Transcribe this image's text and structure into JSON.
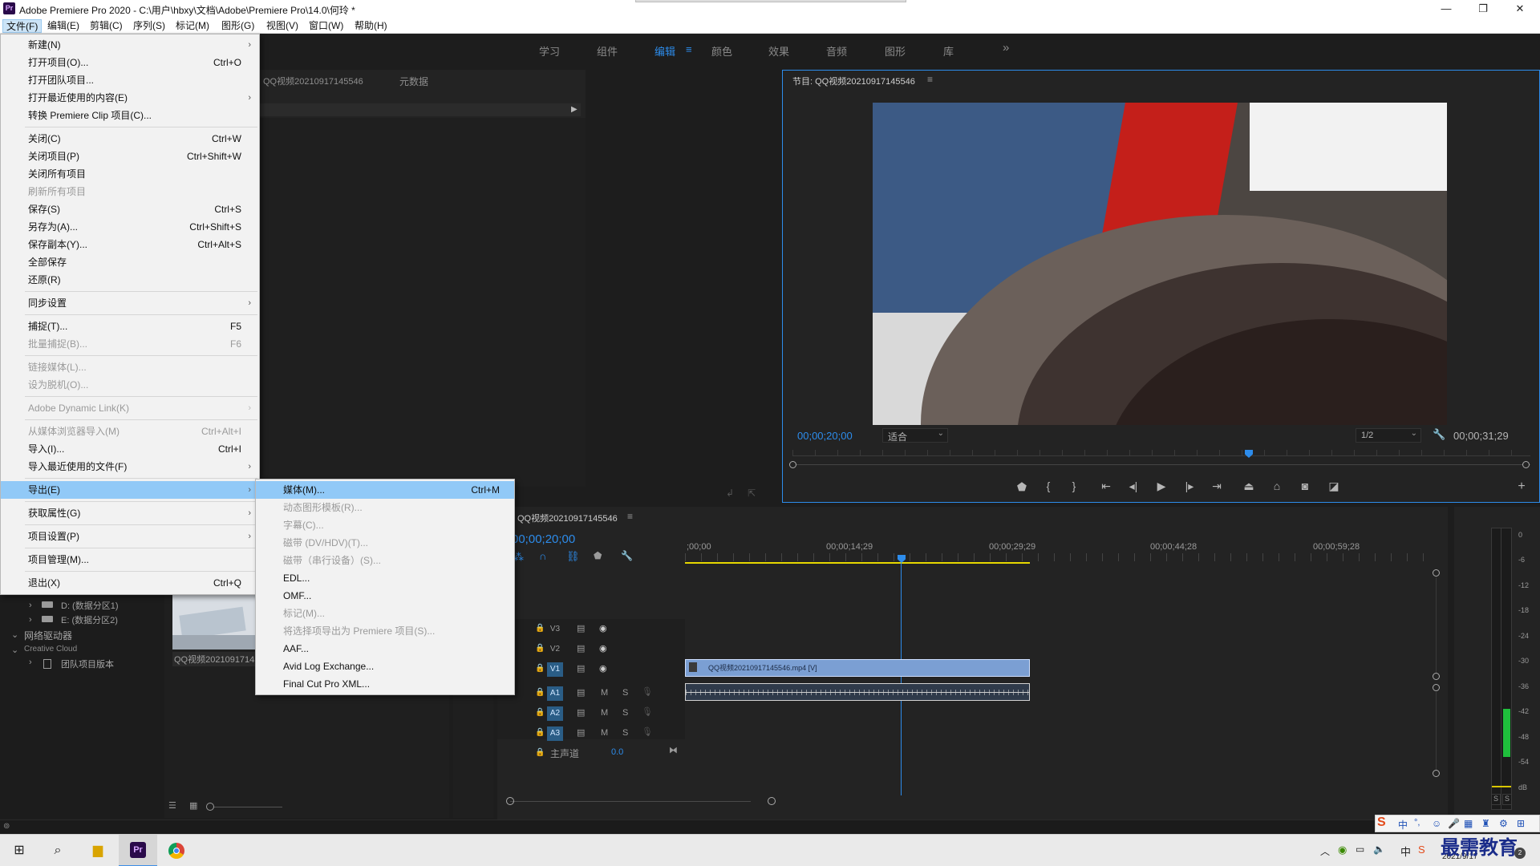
{
  "window": {
    "title": "Adobe Premiere Pro 2020 - C:\\用户\\hbxy\\文档\\Adobe\\Premiere Pro\\14.0\\何玲 *",
    "logo_text": "Pr"
  },
  "menubar": {
    "items": [
      "文件(F)",
      "编辑(E)",
      "剪辑(C)",
      "序列(S)",
      "标记(M)",
      "图形(G)",
      "视图(V)",
      "窗口(W)",
      "帮助(H)"
    ]
  },
  "workspaces": {
    "tabs": [
      "学习",
      "组件",
      "编辑",
      "颜色",
      "效果",
      "音频",
      "图形",
      "库"
    ],
    "active": "编辑",
    "overflow": "»"
  },
  "file_menu": {
    "items": [
      {
        "label": "新建(N)",
        "shortcut": "",
        "submenu": true
      },
      {
        "label": "打开项目(O)...",
        "shortcut": "Ctrl+O"
      },
      {
        "label": "打开团队项目..."
      },
      {
        "label": "打开最近使用的内容(E)",
        "submenu": true
      },
      {
        "label": "转换 Premiere Clip 项目(C)..."
      },
      {
        "label": "关闭(C)",
        "shortcut": "Ctrl+W"
      },
      {
        "label": "关闭项目(P)",
        "shortcut": "Ctrl+Shift+W"
      },
      {
        "label": "关闭所有项目"
      },
      {
        "label": "刷新所有项目",
        "disabled": true
      },
      {
        "label": "保存(S)",
        "shortcut": "Ctrl+S"
      },
      {
        "label": "另存为(A)...",
        "shortcut": "Ctrl+Shift+S"
      },
      {
        "label": "保存副本(Y)...",
        "shortcut": "Ctrl+Alt+S"
      },
      {
        "label": "全部保存"
      },
      {
        "label": "还原(R)"
      },
      {
        "label": "同步设置",
        "submenu": true
      },
      {
        "label": "捕捉(T)...",
        "shortcut": "F5"
      },
      {
        "label": "批量捕捉(B)...",
        "shortcut": "F6",
        "disabled": true
      },
      {
        "label": "链接媒体(L)...",
        "disabled": true
      },
      {
        "label": "设为脱机(O)...",
        "disabled": true
      },
      {
        "label": "Adobe Dynamic Link(K)",
        "disabled": true,
        "submenu": true
      },
      {
        "label": "从媒体浏览器导入(M)",
        "shortcut": "Ctrl+Alt+I",
        "disabled": true
      },
      {
        "label": "导入(I)...",
        "shortcut": "Ctrl+I"
      },
      {
        "label": "导入最近使用的文件(F)",
        "submenu": true
      },
      {
        "label": "导出(E)",
        "submenu": true,
        "highlighted": true
      },
      {
        "label": "获取属性(G)",
        "submenu": true
      },
      {
        "label": "项目设置(P)",
        "submenu": true
      },
      {
        "label": "项目管理(M)..."
      },
      {
        "label": "退出(X)",
        "shortcut": "Ctrl+Q"
      }
    ]
  },
  "export_submenu": {
    "items": [
      {
        "label": "媒体(M)...",
        "shortcut": "Ctrl+M",
        "highlighted": true
      },
      {
        "label": "动态图形模板(R)...",
        "disabled": true
      },
      {
        "label": "字幕(C)...",
        "disabled": true
      },
      {
        "label": "磁带 (DV/HDV)(T)...",
        "disabled": true
      },
      {
        "label": "磁带（串行设备）(S)...",
        "disabled": true
      },
      {
        "label": "EDL..."
      },
      {
        "label": "OMF..."
      },
      {
        "label": "标记(M)...",
        "disabled": true
      },
      {
        "label": "将选择项导出为 Premiere 项目(S)...",
        "disabled": true
      },
      {
        "label": "AAF..."
      },
      {
        "label": "Avid Log Exchange..."
      },
      {
        "label": "Final Cut Pro XML..."
      }
    ]
  },
  "source_panel": {
    "tabs": [
      "QQ视频20210917145546",
      "元数据"
    ]
  },
  "media_browser": {
    "drives": [
      "D: (数据分区1)",
      "E: (数据分区2)"
    ],
    "network": "网络驱动器",
    "cloud": "Creative Cloud",
    "team": "团队项目版本",
    "thumb_label": "QQ视频20210917145546"
  },
  "program_monitor": {
    "title": "节目: QQ视频20210917145546",
    "timecode_current": "00;00;20;00",
    "fit": "适合",
    "resolution": "1/2",
    "timecode_duration": "00;00;31;29"
  },
  "timeline": {
    "sequence_name": "QQ视频20210917145546",
    "timecode": "00;00;20;00",
    "ruler": [
      ";00;00",
      "00;00;14;29",
      "00;00;29;29",
      "00;00;44;28",
      "00;00;59;28"
    ],
    "video_tracks": [
      "V3",
      "V2",
      "V1"
    ],
    "audio_tracks": [
      "A1",
      "A2",
      "A3"
    ],
    "master_label": "主声道",
    "master_value": "0.0",
    "clip_video_label": "QQ视频20210917145546.mp4 [V]",
    "mute": "M",
    "solo": "S"
  },
  "meters": {
    "scale": [
      "0",
      "-6",
      "-12",
      "-18",
      "-24",
      "-30",
      "-36",
      "-42",
      "-48",
      "-54",
      "dB"
    ],
    "solo_labels": [
      "S",
      "S"
    ]
  },
  "taskbar": {
    "date": "2021/9/17",
    "ime": "中",
    "watermark": "最需教育"
  }
}
